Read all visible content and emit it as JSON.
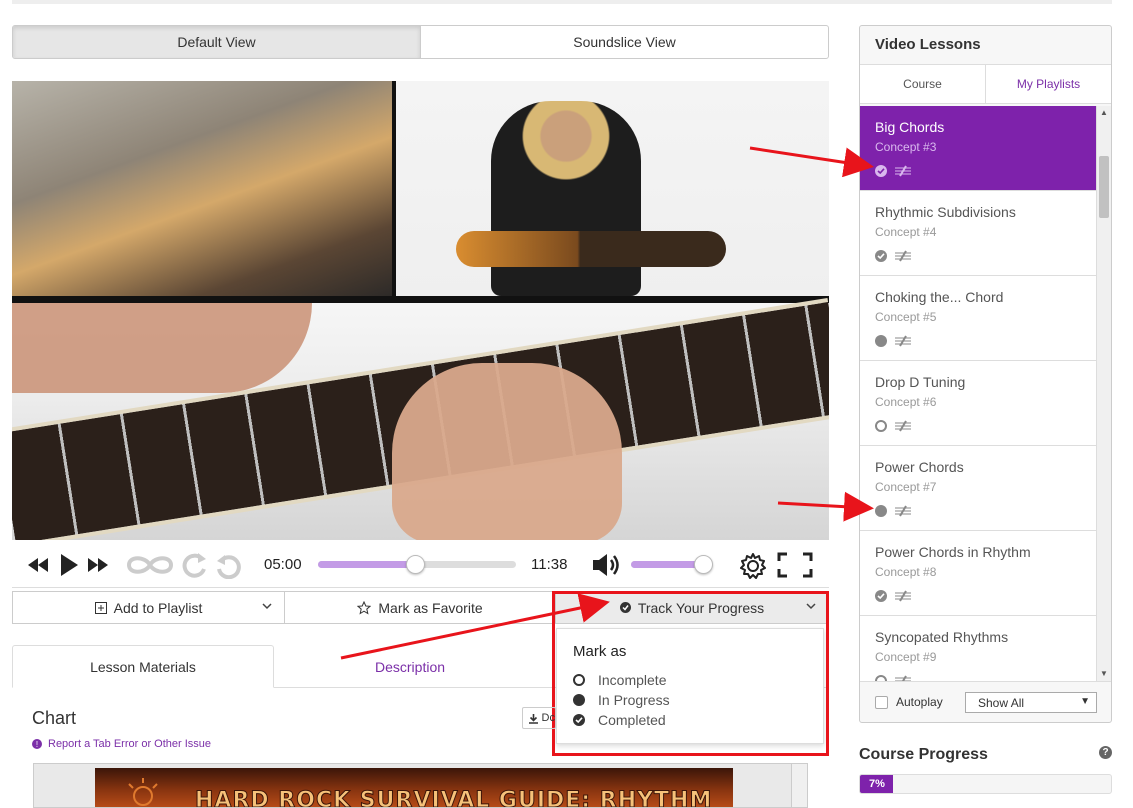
{
  "view_tabs": {
    "default": "Default View",
    "soundslice": "Soundslice View"
  },
  "player": {
    "current_time": "05:00",
    "duration": "11:38",
    "progress": 0.49,
    "volume": 0.88
  },
  "actions": {
    "add_playlist": "Add to Playlist",
    "favorite": "Mark as Favorite",
    "track_progress": "Track Your Progress"
  },
  "track_menu": {
    "title": "Mark as",
    "items": [
      {
        "label": "Incomplete",
        "icon": "empty-circle-icon"
      },
      {
        "label": "In Progress",
        "icon": "filled-circle-icon"
      },
      {
        "label": "Completed",
        "icon": "check-circle-icon"
      }
    ]
  },
  "lesson_tabs": {
    "materials": "Lesson Materials",
    "description": "Description"
  },
  "materials": {
    "chart_title": "Chart",
    "report_link": "Report a Tab Error or Other Issue",
    "download_label": "Dc",
    "pdf_banner": "HARD ROCK SURVIVAL GUIDE: RHYTHM EDITION"
  },
  "sidebar": {
    "title": "Video Lessons",
    "tabs": [
      "Course",
      "My Playlists"
    ],
    "lessons": [
      {
        "title": "Big Chords",
        "concept": "Concept #3",
        "status": "completed",
        "active": true
      },
      {
        "title": "Rhythmic Subdivisions",
        "concept": "Concept #4",
        "status": "completed"
      },
      {
        "title": "Choking the... Chord",
        "concept": "Concept #5",
        "status": "in-progress"
      },
      {
        "title": "Drop D Tuning",
        "concept": "Concept #6",
        "status": "incomplete"
      },
      {
        "title": "Power Chords",
        "concept": "Concept #7",
        "status": "in-progress"
      },
      {
        "title": "Power Chords in Rhythm",
        "concept": "Concept #8",
        "status": "completed"
      },
      {
        "title": "Syncopated Rhythms",
        "concept": "Concept #9",
        "status": "incomplete"
      }
    ],
    "autoplay": "Autoplay",
    "show_filter": "Show All"
  },
  "course_progress": {
    "title": "Course Progress",
    "percent_label": "7%",
    "percent": 7
  },
  "colors": {
    "accent": "#7e22ab",
    "annotation": "#e8141b",
    "seek_fill": "#c39be6"
  }
}
